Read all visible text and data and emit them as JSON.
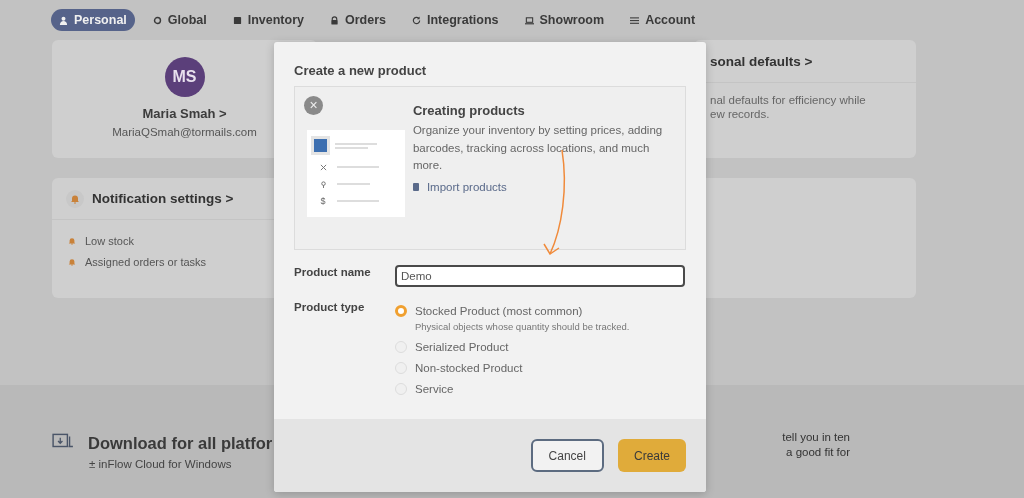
{
  "tabs": [
    {
      "label": "Personal",
      "selected": true
    },
    {
      "label": "Global",
      "selected": false
    },
    {
      "label": "Inventory",
      "selected": false
    },
    {
      "label": "Orders",
      "selected": false
    },
    {
      "label": "Integrations",
      "selected": false
    },
    {
      "label": "Showroom",
      "selected": false
    },
    {
      "label": "Account",
      "selected": false
    }
  ],
  "profile": {
    "initials": "MS",
    "name": "Maria Smah",
    "chevron": ">",
    "email": "MariaQSmah@tormails.com"
  },
  "notifications": {
    "title": "Notification settings",
    "chevron": ">",
    "items": [
      "Low stock",
      "Assigned orders or tasks"
    ]
  },
  "defaults_card": {
    "title": "sonal defaults",
    "chevron": ">",
    "text": [
      "nal defaults for efficiency while",
      "ew records."
    ]
  },
  "download": {
    "title": "Download for all platfor",
    "link": "± inFlow Cloud for Windows"
  },
  "side_text": [
    "tell you in ten",
    "a good fit for"
  ],
  "dialog": {
    "title": "Create a new product",
    "info": {
      "close": "×",
      "heading": "Creating products",
      "text": "Organize your inventory by setting prices, adding barcodes, tracking across locations, and much more.",
      "link": "Import products",
      "illustration_symbol": "$"
    },
    "name_label": "Product name",
    "name_value": "Demo",
    "type_label": "Product type",
    "types": [
      {
        "label": "Stocked Product (most common)",
        "selected": true,
        "description": "Physical objects whose quantity should be tracked."
      },
      {
        "label": "Serialized Product",
        "selected": false
      },
      {
        "label": "Non-stocked Product",
        "selected": false
      },
      {
        "label": "Service",
        "selected": false
      }
    ],
    "buttons": [
      {
        "label": "Cancel",
        "kind": "secondary"
      },
      {
        "label": "Create",
        "kind": "primary"
      }
    ]
  }
}
